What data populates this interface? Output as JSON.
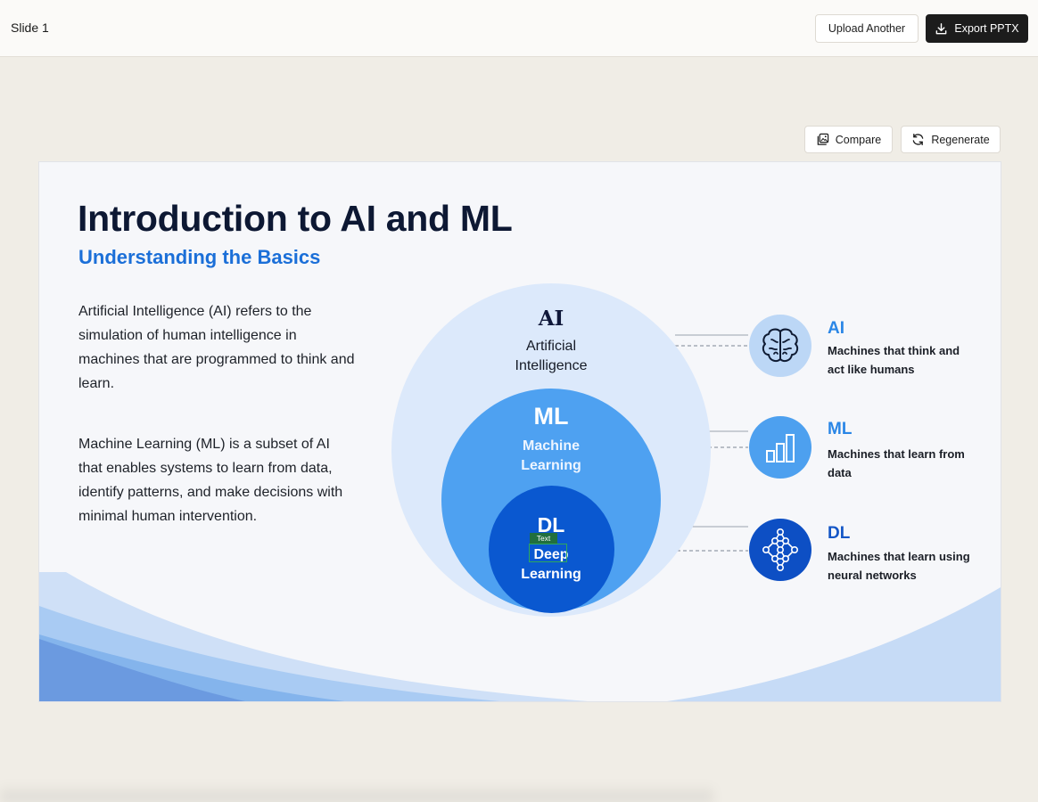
{
  "header": {
    "slide_name": "Slide 1",
    "upload_label": "Upload Another",
    "export_label": "Export PPTX"
  },
  "toolbar": {
    "compare_label": "Compare",
    "regenerate_label": "Regenerate"
  },
  "slide": {
    "title": "Introduction to AI and ML",
    "subtitle": "Understanding the Basics",
    "paragraph1": "Artificial Intelligence (AI) refers to the simulation of human intelligence in machines that are programmed to think and learn.",
    "paragraph2": "Machine Learning (ML) is a subset of AI that enables systems to learn from data, identify patterns, and make decisions with minimal human intervention.",
    "diagram": {
      "ai_abbr": "AI",
      "ai_name": "Artificial Intelligence",
      "ml_abbr": "ML",
      "ml_name": "Machine Learning",
      "dl_abbr": "DL",
      "dl_name": "Deep Learning"
    },
    "legend": [
      {
        "abbr": "AI",
        "desc": "Machines that think and act like humans",
        "icon": "brain-icon"
      },
      {
        "abbr": "ML",
        "desc": "Machines that learn from data",
        "icon": "bar-chart-icon"
      },
      {
        "abbr": "DL",
        "desc": "Machines that learn using neural networks",
        "icon": "neural-network-icon"
      }
    ]
  },
  "selection_tag": "Text",
  "colors": {
    "primary_blue": "#1b6fd8",
    "dark_navy": "#0d1833",
    "ai_circle": "#dce9fb",
    "ml_circle": "#4ea1f1",
    "dl_circle": "#0a58d0",
    "export_button": "#1c1c1c"
  }
}
